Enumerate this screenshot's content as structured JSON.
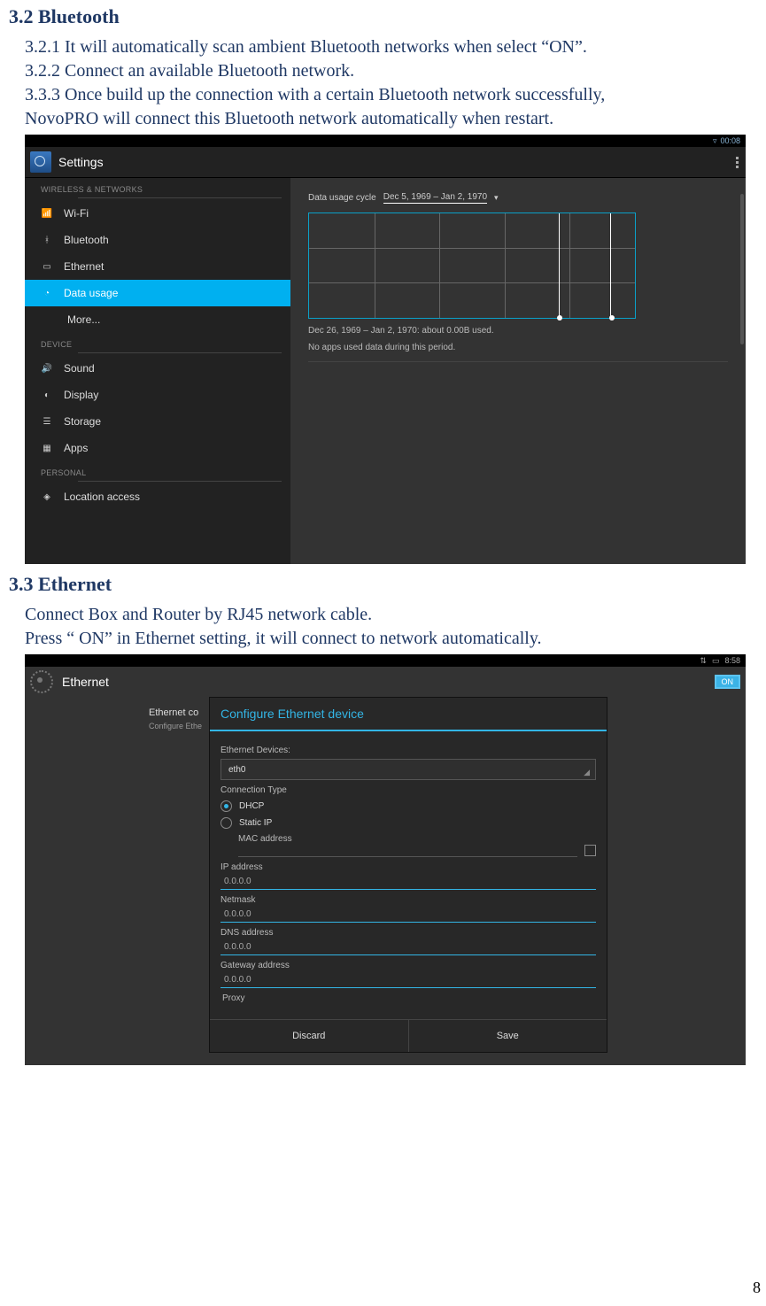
{
  "sections": {
    "bluetooth": {
      "heading": "3.2 Bluetooth",
      "p1": "3.2.1 It will automatically scan ambient Bluetooth networks when select “ON”.",
      "p2": "3.2.2 Connect an available Bluetooth network.",
      "p3a": "3.3.3 Once build up the connection with a certain Bluetooth network successfully,",
      "p3b": "NovoPRO will connect this Bluetooth network automatically when restart."
    },
    "ethernet": {
      "heading": "3.3 Ethernet",
      "p1": "Connect Box and Router by RJ45 network cable.",
      "p2": "Press “ ON” in Ethernet setting, it will connect to network automatically."
    }
  },
  "screenshot1": {
    "statusbar_time": "00:08",
    "app_title": "Settings",
    "groups": {
      "wireless": "WIRELESS & NETWORKS",
      "device": "DEVICE",
      "personal": "PERSONAL"
    },
    "items": {
      "wifi": "Wi-Fi",
      "bluetooth": "Bluetooth",
      "ethernet": "Ethernet",
      "datausage": "Data usage",
      "more": "More...",
      "sound": "Sound",
      "display": "Display",
      "storage": "Storage",
      "apps": "Apps",
      "location": "Location access"
    },
    "content": {
      "cycle_label": "Data usage cycle",
      "cycle_value": "Dec 5, 1969 – Jan 2, 1970",
      "caption1": "Dec 26, 1969 – Jan 2, 1970: about 0.00B used.",
      "caption2": "No apps used data during this period."
    }
  },
  "screenshot2": {
    "statusbar_time": "8:58",
    "app_title": "Ethernet",
    "on_label": "ON",
    "bg_title": "Ethernet co",
    "bg_sub": "Configure Ethe",
    "dialog": {
      "title": "Configure Ethernet device",
      "devices_label": "Ethernet Devices:",
      "devices_value": "eth0",
      "conn_type_label": "Connection Type",
      "dhcp": "DHCP",
      "static": "Static IP",
      "mac_label": "MAC address",
      "ip_label": "IP address",
      "ip_value": "0.0.0.0",
      "netmask_label": "Netmask",
      "netmask_value": "0.0.0.0",
      "dns_label": "DNS address",
      "dns_value": "0.0.0.0",
      "gateway_label": "Gateway address",
      "gateway_value": "0.0.0.0",
      "proxy_label": "Proxy",
      "discard": "Discard",
      "save": "Save"
    }
  },
  "page_number": "8"
}
